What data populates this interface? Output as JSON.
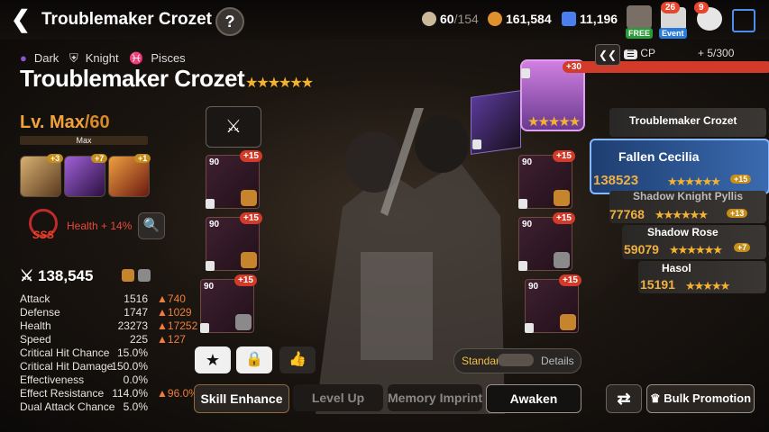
{
  "header": {
    "title": "Troublemaker Crozet",
    "help_label": "?",
    "stamina": "60",
    "stamina_max": "/154",
    "gold": "161,584",
    "crystals": "11,196",
    "free_badge": "FREE",
    "event_badge": "Event",
    "event_count": "26",
    "chat_count": "9"
  },
  "hero": {
    "element": "Dark",
    "class": "Knight",
    "zodiac": "Pisces",
    "name": "Troublemaker Crozet",
    "stars": "★★★★★★",
    "level": "Lv. Max",
    "level_max": "/60",
    "max_label": "Max",
    "skills": [
      {
        "name": "skill-1",
        "plus": "+3",
        "color": "#b88a3a"
      },
      {
        "name": "skill-2",
        "plus": "+7",
        "color": "#7a3aa8"
      },
      {
        "name": "skill-3",
        "plus": "+1",
        "color": "#c0551e"
      }
    ],
    "imprint_grade": "SSS",
    "imprint_bonus": "Health + 14%",
    "combat_power": "138,545"
  },
  "stats": [
    {
      "label": "Attack",
      "value": "1516",
      "bonus": "740"
    },
    {
      "label": "Defense",
      "value": "1747",
      "bonus": "1029"
    },
    {
      "label": "Health",
      "value": "23273",
      "bonus": "17252"
    },
    {
      "label": "Speed",
      "value": "225",
      "bonus": "127"
    },
    {
      "label": "Critical Hit Chance",
      "value": "15.0%",
      "bonus": ""
    },
    {
      "label": "Critical Hit Damage",
      "value": "150.0%",
      "bonus": ""
    },
    {
      "label": "Effectiveness",
      "value": "0.0%",
      "bonus": ""
    },
    {
      "label": "Effect Resistance",
      "value": "114.0%",
      "bonus": "96.0%"
    },
    {
      "label": "Dual Attack Chance",
      "value": "5.0%",
      "bonus": ""
    }
  ],
  "equipment_left": [
    {
      "level": "90",
      "plus": "+15"
    },
    {
      "level": "90",
      "plus": "+15"
    },
    {
      "level": "90",
      "plus": "+15"
    }
  ],
  "equipment_right": [
    {
      "level": "90",
      "plus": "+15"
    },
    {
      "level": "90",
      "plus": "+15"
    },
    {
      "level": "90",
      "plus": "+15"
    }
  ],
  "artifact": {
    "plus": "+30",
    "stars": "★★★★★"
  },
  "tabs": {
    "skill_enhance": "Skill Enhance",
    "level_up": "Level Up",
    "memory_imprint": "Memory Imprint",
    "awaken": "Awaken",
    "bulk_promotion": "Bulk Promotion"
  },
  "toggle": {
    "left": "Standard",
    "right": "Details"
  },
  "roster": {
    "sort_label": "CP",
    "count": "5/300",
    "heroes": [
      {
        "name": "Troublemaker Crozet",
        "cp": "",
        "stars": "★★★★★★",
        "plus": ""
      },
      {
        "name": "Fallen Cecilia",
        "cp": "138523",
        "stars": "★★★★★★",
        "plus": "+15"
      },
      {
        "name": "Shadow Knight Pyllis",
        "cp": "77768",
        "stars": "★★★★★★",
        "plus": "+13"
      },
      {
        "name": "Shadow Rose",
        "cp": "59079",
        "stars": "★★★★★★",
        "plus": "+7"
      },
      {
        "name": "Hasol",
        "cp": "15191",
        "stars": "★★★★★",
        "plus": ""
      }
    ]
  },
  "colors": {
    "accent": "#f2a23b",
    "bonus": "#ef7d3b",
    "dark": "#8a55d0"
  }
}
